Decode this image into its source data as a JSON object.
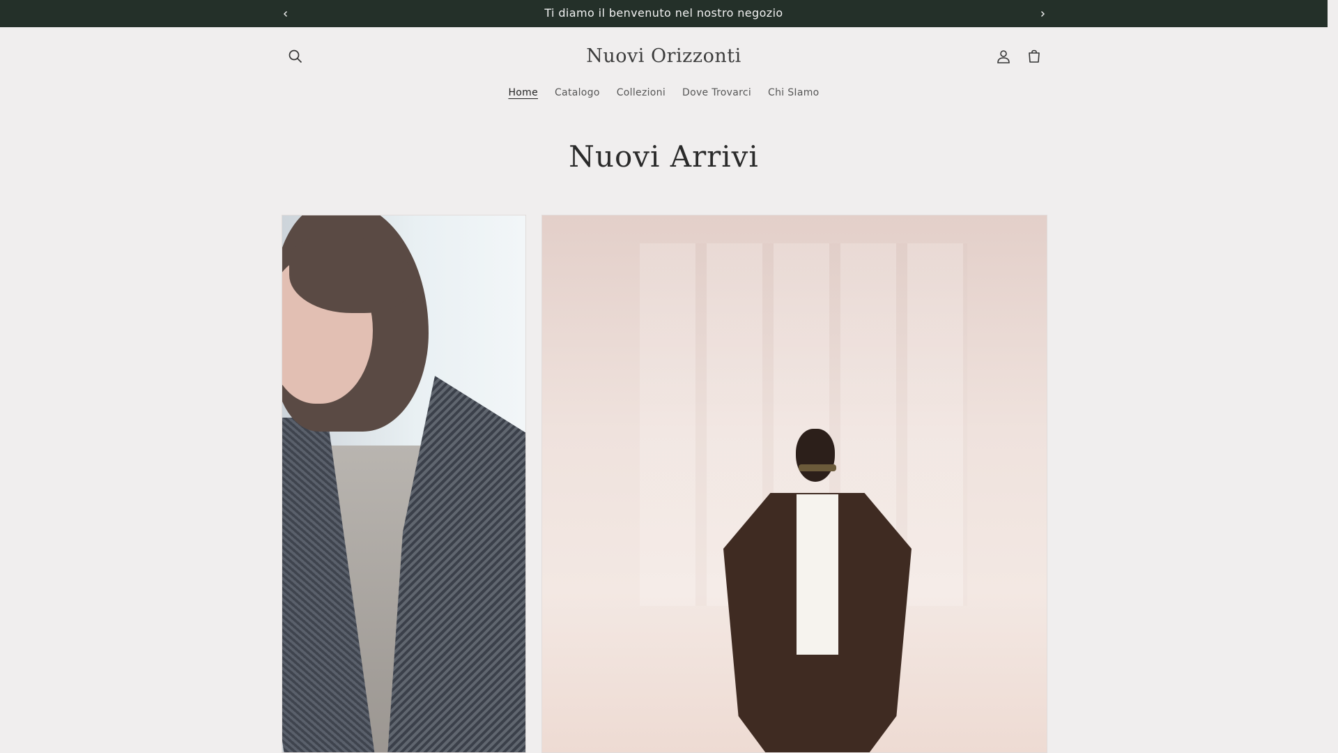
{
  "announcement": {
    "message": "Ti diamo il benvenuto nel nostro negozio",
    "prev_icon": "chevron-left-icon",
    "next_icon": "chevron-right-icon"
  },
  "header": {
    "logo": "Nuovi Orizzonti",
    "icons": [
      "search-icon",
      "account-icon",
      "cart-icon"
    ]
  },
  "nav": {
    "items": [
      "Home",
      "Catalogo",
      "Collezioni",
      "Dove Trovarci",
      "Chi SIamo"
    ],
    "active": "Home"
  },
  "main": {
    "section_title": "Nuovi Arrivi"
  },
  "colors": {
    "announcement_bg": "#243029",
    "page_bg": "#f0eeee"
  }
}
